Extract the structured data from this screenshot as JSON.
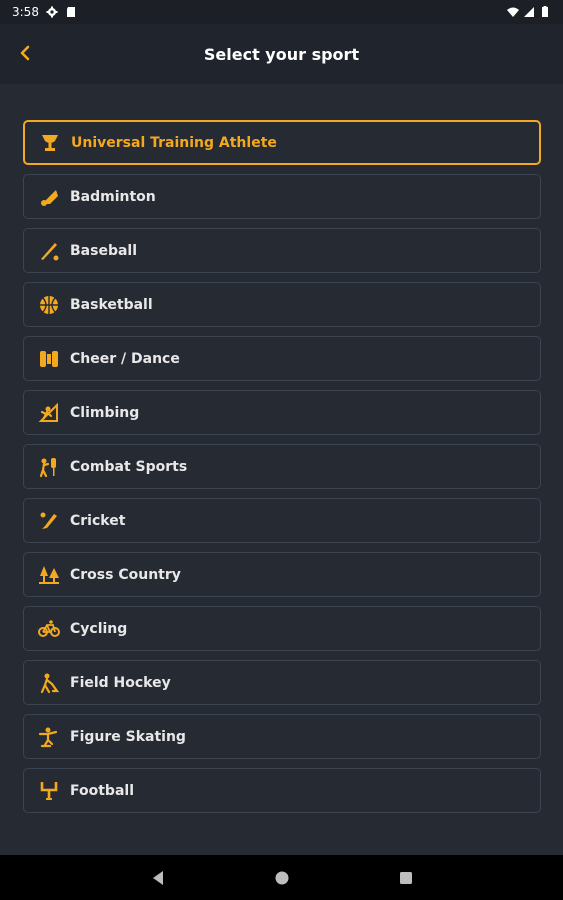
{
  "status_bar": {
    "time": "3:58"
  },
  "app_bar": {
    "title": "Select your sport"
  },
  "colors": {
    "accent": "#f2a91f",
    "background": "#262a33",
    "item_border": "#3d4451"
  },
  "sports": [
    {
      "label": "Universal Training Athlete",
      "icon": "trophy-icon",
      "selected": true
    },
    {
      "label": "Badminton",
      "icon": "shuttlecock-icon"
    },
    {
      "label": "Baseball",
      "icon": "baseball-bat-icon"
    },
    {
      "label": "Basketball",
      "icon": "basketball-icon"
    },
    {
      "label": "Cheer / Dance",
      "icon": "pom-pom-icon"
    },
    {
      "label": "Climbing",
      "icon": "climbing-icon"
    },
    {
      "label": "Combat Sports",
      "icon": "boxing-icon"
    },
    {
      "label": "Cricket",
      "icon": "cricket-bat-icon"
    },
    {
      "label": "Cross Country",
      "icon": "trees-icon"
    },
    {
      "label": "Cycling",
      "icon": "bicycle-icon"
    },
    {
      "label": "Field Hockey",
      "icon": "hockey-player-icon"
    },
    {
      "label": "Figure Skating",
      "icon": "skater-icon"
    },
    {
      "label": "Football",
      "icon": "goalpost-icon"
    }
  ]
}
